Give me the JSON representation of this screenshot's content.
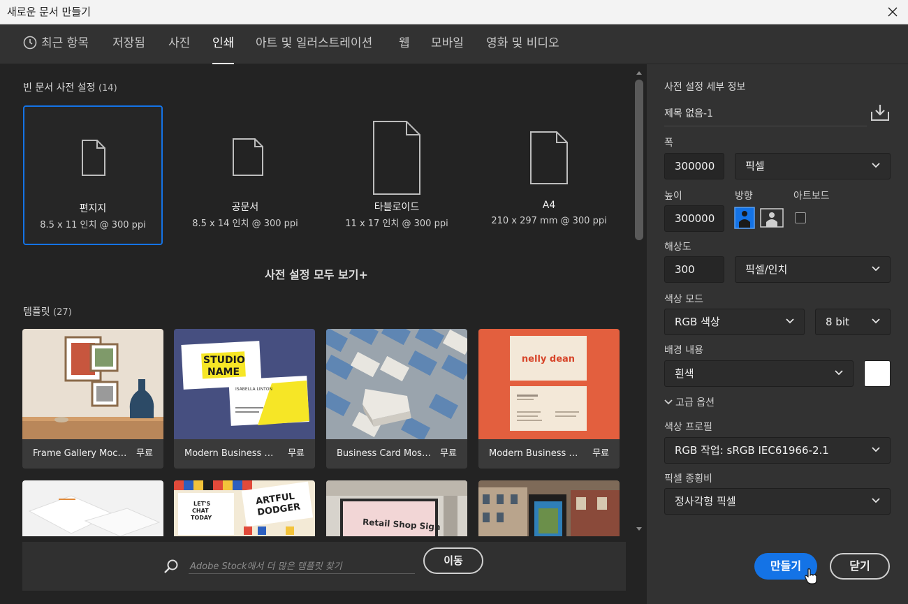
{
  "window": {
    "title": "새로운 문서 만들기"
  },
  "tabs": [
    {
      "label": "최근 항목",
      "icon": "clock-icon"
    },
    {
      "label": "저장됨"
    },
    {
      "label": "사진"
    },
    {
      "label": "인쇄",
      "active": true
    },
    {
      "label": "아트 및 일러스트레이션"
    },
    {
      "label": "웹"
    },
    {
      "label": "모바일"
    },
    {
      "label": "영화 및 비디오"
    }
  ],
  "blank": {
    "title": "빈 문서 사전 설정",
    "count": "(14)",
    "presets": [
      {
        "name": "편지지",
        "dims": "8.5 x 11 인치 @ 300 ppi",
        "selected": true
      },
      {
        "name": "공문서",
        "dims": "8.5 x 14 인치 @ 300 ppi"
      },
      {
        "name": "타블로이드",
        "dims": "11 x 17 인치 @ 300 ppi"
      },
      {
        "name": "A4",
        "dims": "210 x 297 mm @ 300 ppi"
      }
    ],
    "view_all": "사전 설정 모두 보기+"
  },
  "templates": {
    "title": "템플릿",
    "count": "(27)",
    "items": [
      {
        "name": "Frame Gallery Mock...",
        "price": "무료"
      },
      {
        "name": "Modern Business Car...",
        "price": "무료"
      },
      {
        "name": "Business Card Mosai...",
        "price": "무료"
      },
      {
        "name": "Modern Business Car...",
        "price": "무료"
      }
    ],
    "thumb_text": {
      "studio": "STUDIO",
      "name": "NAME",
      "isabella": "ISABELLA LINTON",
      "nelly": "nelly dean",
      "lets": "LET'S",
      "chat": "CHAT",
      "today": "TODAY",
      "artful": "ARTFUL",
      "dodger": "DODGER",
      "retail": "Retail Shop Sign"
    }
  },
  "stock_search": {
    "placeholder": "Adobe Stock에서 더 많은 템플릿 찾기",
    "go": "이동"
  },
  "details": {
    "title": "사전 설정 세부 정보",
    "doc_name": "제목 없음-1",
    "width_label": "폭",
    "width": "300000",
    "width_unit": "픽셀",
    "height_label": "높이",
    "height": "300000",
    "orientation_label": "방향",
    "artboard_label": "아트보드",
    "resolution_label": "해상도",
    "resolution": "300",
    "resolution_unit": "픽셀/인치",
    "color_mode_label": "색상 모드",
    "color_mode": "RGB 색상",
    "bit_depth": "8 bit",
    "background_label": "배경 내용",
    "background": "흰색",
    "background_swatch": "#ffffff",
    "advanced_label": "고급 옵션",
    "profile_label": "색상 프로필",
    "profile": "RGB 작업: sRGB IEC61966-2.1",
    "pixel_aspect_label": "픽셀 종횡비",
    "pixel_aspect": "정사각형 픽셀",
    "create": "만들기",
    "close": "닫기"
  },
  "colors": {
    "accent": "#1473e6",
    "bg": "#323232",
    "panel": "#232323"
  }
}
